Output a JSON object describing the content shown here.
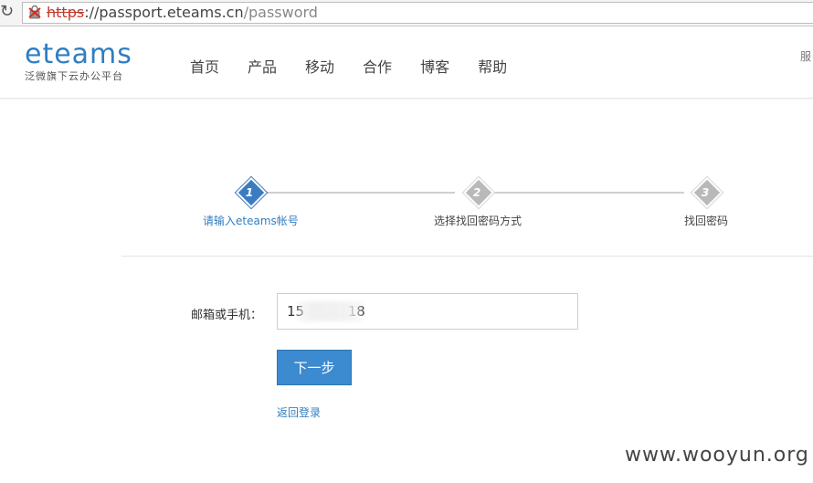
{
  "browser": {
    "url_scheme": "https",
    "url_host": "://passport.eteams.cn",
    "url_path": "/password"
  },
  "header": {
    "logo_text": "eteams",
    "logo_sub": "泛微旗下云办公平台",
    "nav": [
      "首页",
      "产品",
      "移动",
      "合作",
      "博客",
      "帮助"
    ],
    "right_text": "服"
  },
  "steps": [
    {
      "num": "1",
      "label": "请输入eteams帐号",
      "active": true
    },
    {
      "num": "2",
      "label": "选择找回密码方式",
      "active": false
    },
    {
      "num": "3",
      "label": "找回密码",
      "active": false
    }
  ],
  "form": {
    "label": "邮箱或手机：",
    "value": "15          18",
    "next_label": "下一步",
    "back_label": "返回登录"
  },
  "colors": {
    "accent": "#2f7ec2",
    "active_step": "#3a7cc1",
    "inactive_step": "#b9b9b9"
  },
  "watermark": "www.wooyun.org"
}
